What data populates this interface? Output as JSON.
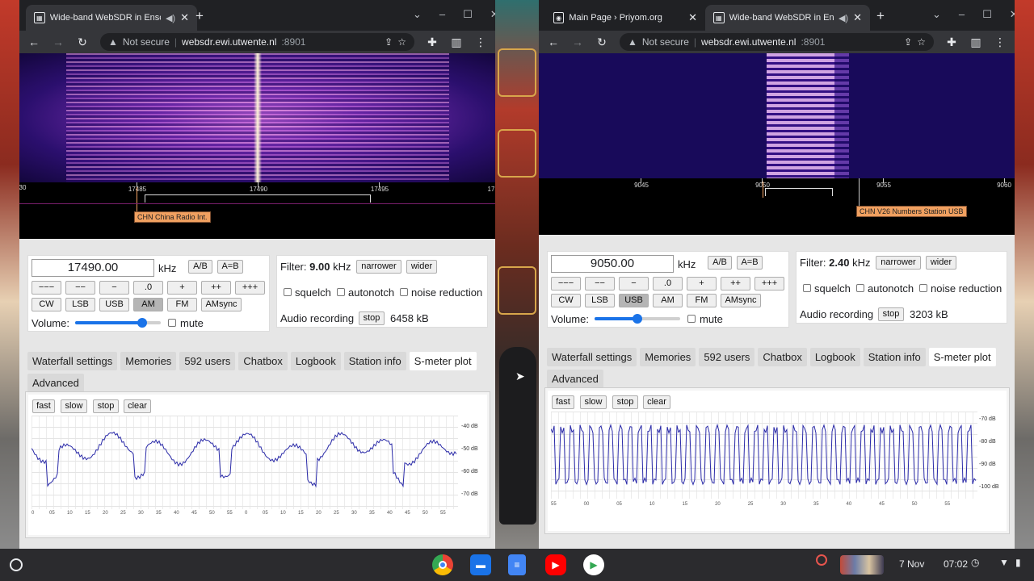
{
  "left_window": {
    "tab_title": "Wide-band WebSDR in Ensc",
    "url_warning": "Not secure",
    "url_host": "websdr.ewi.utwente.nl",
    "url_port": ":8901",
    "scale_ticks": [
      "30",
      "17485",
      "17490",
      "17495",
      "17"
    ],
    "station_label": "CHN China Radio Int.",
    "freq_value": "17490.00",
    "freq_unit": "kHz",
    "ab": "A/B",
    "aeqb": "A=B",
    "step_buttons": [
      "−−−",
      "−−",
      "−",
      ".0",
      "+",
      "++",
      "+++"
    ],
    "modes": [
      "CW",
      "LSB",
      "USB",
      "AM",
      "FM",
      "AMsync"
    ],
    "active_mode": "AM",
    "volume_label": "Volume:",
    "volume_level": 0.78,
    "mute_label": "mute",
    "filter_label": "Filter:",
    "filter_value": "9.00",
    "filter_unit": "kHz",
    "narrower": "narrower",
    "wider": "wider",
    "squelch": "squelch",
    "autonotch": "autonotch",
    "noise_reduction": "noise reduction",
    "audio_recording": "Audio recording",
    "stop": "stop",
    "recording_size": "6458 kB",
    "tabs": [
      "Waterfall settings",
      "Memories",
      "592 users",
      "Chatbox",
      "Logbook",
      "Station info",
      "S-meter plot",
      "Advanced"
    ],
    "active_tab": "S-meter plot",
    "smeter_buttons": [
      "fast",
      "slow",
      "stop",
      "clear"
    ],
    "db_labels": [
      "-40 dB",
      "-50 dB",
      "-60 dB",
      "-70 dB"
    ],
    "x_labels": [
      "0",
      "05",
      "10",
      "15",
      "20",
      "25",
      "30",
      "35",
      "40",
      "45",
      "50",
      "55",
      "0",
      "05",
      "10",
      "15",
      "20",
      "25",
      "30",
      "35",
      "40",
      "45",
      "50",
      "55"
    ]
  },
  "right_window": {
    "tab1_title": "Main Page › Priyom.org",
    "tab_title": "Wide-band WebSDR in Ensc",
    "url_warning": "Not secure",
    "url_host": "websdr.ewi.utwente.nl",
    "url_port": ":8901",
    "scale_ticks": [
      "9045",
      "9050",
      "9055",
      "9060"
    ],
    "station_label": "CHN V26 Numbers Station USB",
    "freq_value": "9050.00",
    "freq_unit": "kHz",
    "ab": "A/B",
    "aeqb": "A=B",
    "step_buttons": [
      "−−−",
      "−−",
      "−",
      ".0",
      "+",
      "++",
      "+++"
    ],
    "modes": [
      "CW",
      "LSB",
      "USB",
      "AM",
      "FM",
      "AMsync"
    ],
    "active_mode": "USB",
    "volume_label": "Volume:",
    "volume_level": 0.5,
    "mute_label": "mute",
    "filter_label": "Filter:",
    "filter_value": "2.40",
    "filter_unit": "kHz",
    "narrower": "narrower",
    "wider": "wider",
    "squelch": "squelch",
    "autonotch": "autonotch",
    "noise_reduction": "noise reduction",
    "audio_recording": "Audio recording",
    "stop": "stop",
    "recording_size": "3203 kB",
    "tabs": [
      "Waterfall settings",
      "Memories",
      "592 users",
      "Chatbox",
      "Logbook",
      "Station info",
      "S-meter plot",
      "Advanced"
    ],
    "active_tab": "S-meter plot",
    "smeter_buttons": [
      "fast",
      "slow",
      "stop",
      "clear"
    ],
    "db_labels": [
      "-70 dB",
      "-80 dB",
      "-90 dB",
      "-100 dB"
    ],
    "x_labels": [
      "55",
      "00",
      "05",
      "10",
      "15",
      "20",
      "25",
      "30",
      "35",
      "40",
      "45",
      "50",
      "55"
    ]
  },
  "shelf": {
    "date": "7 Nov",
    "time": "07:02",
    "apps": [
      "chrome-icon",
      "files-icon",
      "docs-icon",
      "youtube-icon",
      "play-store-icon"
    ]
  }
}
